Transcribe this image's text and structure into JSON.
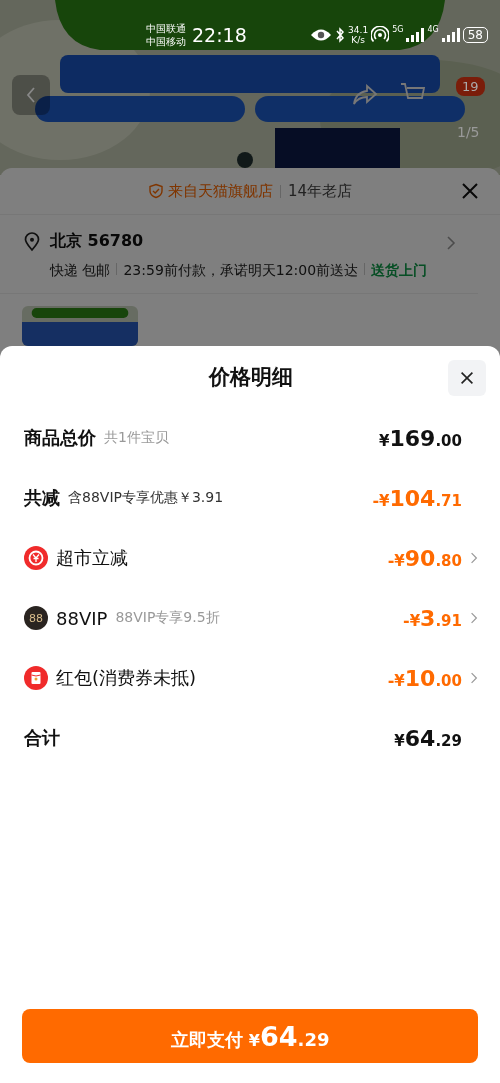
{
  "status_bar": {
    "carriers": [
      "中国联通",
      "中国移动"
    ],
    "time": "22:18",
    "speed": [
      "34.1",
      "K/s"
    ],
    "network_1": "5G",
    "network_2": "4G",
    "battery": "58"
  },
  "product_gallery": {
    "kind": "picture",
    "cart_badge": "19",
    "counter": "1/5"
  },
  "background_sheet": {
    "store_label": "来自天猫旗舰店",
    "store_age": "14年老店",
    "address": "北京 56780",
    "shipping": [
      "快递 包邮",
      "23:59前付款，承诺明天12:00前送达"
    ],
    "delivery_tag": "送货上门"
  },
  "price_sheet": {
    "title": "价格明细",
    "rows": [
      {
        "kind": "summary",
        "label": "商品总价",
        "note": "共1件宝贝",
        "discount": false,
        "expandable": false,
        "amount": {
          "currency": "¥",
          "whole": "169",
          "fraction": ".00"
        }
      },
      {
        "kind": "summary",
        "label": "共减",
        "note": "含88VIP专享优惠￥3.91",
        "discount": true,
        "expandable": false,
        "amount": {
          "sign": "-",
          "currency": "¥",
          "whole": "104",
          "fraction": ".71"
        }
      },
      {
        "kind": "supermarket",
        "label": "超市立减",
        "discount": true,
        "expandable": true,
        "amount": {
          "sign": "-",
          "currency": "¥",
          "whole": "90",
          "fraction": ".80"
        }
      },
      {
        "kind": "vip",
        "label": "88VIP",
        "icon_text": "88",
        "note": "88VIP专享9.5折",
        "discount": true,
        "expandable": true,
        "amount": {
          "sign": "-",
          "currency": "¥",
          "whole": "3",
          "fraction": ".91"
        }
      },
      {
        "kind": "red-packet",
        "label": "红包(消费券未抵)",
        "discount": true,
        "expandable": true,
        "amount": {
          "sign": "-",
          "currency": "¥",
          "whole": "10",
          "fraction": ".00"
        }
      },
      {
        "kind": "summary",
        "label": "合计",
        "discount": false,
        "expandable": false,
        "amount": {
          "currency": "¥",
          "whole": "64",
          "fraction": ".29"
        }
      }
    ],
    "pay_button": {
      "label": "立即支付",
      "currency": "¥",
      "whole": "64",
      "fraction": ".29"
    }
  }
}
